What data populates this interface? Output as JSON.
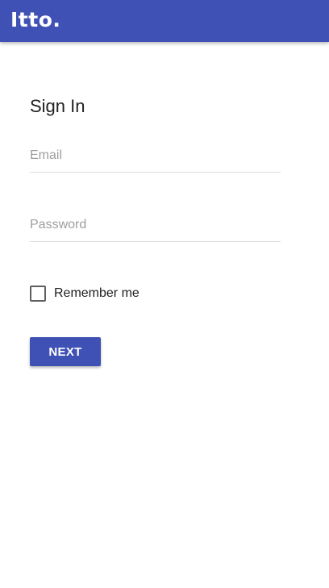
{
  "app_bar": {
    "brand": "Itto."
  },
  "form": {
    "title": "Sign In",
    "email_placeholder": "Email",
    "email_value": "",
    "password_placeholder": "Password",
    "password_value": "",
    "remember_label": "Remember me",
    "remember_checked": false,
    "submit_label": "NEXT"
  },
  "colors": {
    "primary": "#3f51b5",
    "background": "#ffffff",
    "text": "#212121",
    "placeholder": "#9e9e9e",
    "divider": "#dcdcdc"
  }
}
